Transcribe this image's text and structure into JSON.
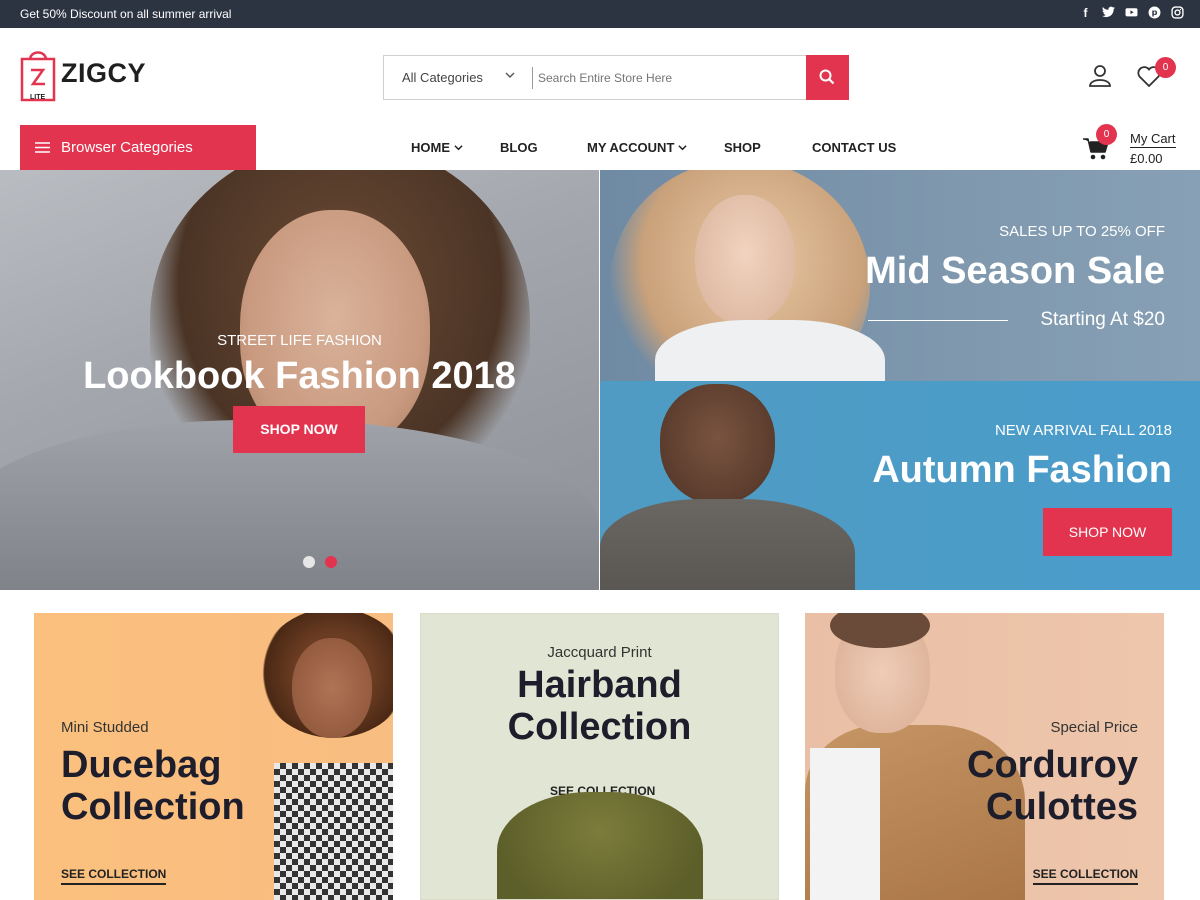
{
  "topbar": {
    "promo": "Get 50% Discount on all summer arrival",
    "socials": [
      "facebook-icon",
      "twitter-icon",
      "youtube-icon",
      "pinterest-icon",
      "instagram-icon"
    ]
  },
  "header": {
    "brand": "ZIGCY",
    "brand_sub": "LITE",
    "search": {
      "category": "All Categories",
      "placeholder": "Search Entire Store Here"
    },
    "wishlist_count": "0"
  },
  "nav": {
    "browse_label": "Browser Categories",
    "items": [
      "HOME",
      "BLOG",
      "MY ACCOUNT",
      "SHOP",
      "CONTACT US"
    ],
    "cart": {
      "count": "0",
      "label": "My Cart",
      "amount": "£0.00"
    }
  },
  "hero": {
    "main": {
      "subtitle": "STREET LIFE FASHION",
      "title": "Lookbook Fashion 2018",
      "button": "SHOP NOW",
      "active_slide": 2
    },
    "top_right": {
      "subtitle": "SALES UP TO 25% OFF",
      "title": "Mid Season Sale",
      "price": "Starting At $20"
    },
    "bottom_right": {
      "subtitle": "NEW ARRIVAL FALL 2018",
      "title": "Autumn Fashion",
      "button": "SHOP NOW"
    }
  },
  "collections": [
    {
      "pre": "Mini Studded",
      "title_1": "Ducebag",
      "title_2": "Collection",
      "link": "SEE COLLECTION"
    },
    {
      "pre": "Jaccquard Print",
      "title_1": "Hairband",
      "title_2": "Collection",
      "link": "SEE COLLECTION"
    },
    {
      "pre": "Special Price",
      "title_1": "Corduroy",
      "title_2": "Culottes",
      "link": "SEE COLLECTION"
    }
  ],
  "colors": {
    "accent": "#e2344f",
    "topbar": "#2c3442"
  }
}
